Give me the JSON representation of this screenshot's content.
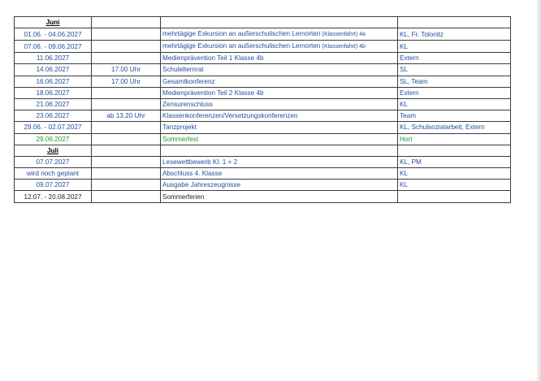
{
  "months": [
    {
      "name": "Juni",
      "rows": [
        {
          "date": "01.06. - 04.06.2027",
          "time": "",
          "event": "mehrtägige Exkursion an außerschulischen Lernorten",
          "event_note": "(Klassenfahrt) 4a",
          "resp": "KL, Fr. Tolonitz",
          "color": "blue"
        },
        {
          "date": "07.06. - 09.06.2027",
          "time": "",
          "event": "mehrtägige Exkursion an außerschulischen Lernorten",
          "event_note": "(Klassenfahrt) 4b",
          "resp": "KL",
          "color": "blue"
        },
        {
          "date": "11.06.2027",
          "time": "",
          "event": "Medienprävention Teil 1 Klasse 4b",
          "event_note": "",
          "resp": "Extern",
          "color": "blue"
        },
        {
          "date": "14.06.2027",
          "time": "17.00 Uhr",
          "event": "Schulelternrat",
          "event_note": "",
          "resp": "SL",
          "color": "blue"
        },
        {
          "date": "16.06.2027",
          "time": "17.00 Uhr",
          "event": "Gesamtkonferenz",
          "event_note": "",
          "resp": "SL, Team",
          "color": "blue"
        },
        {
          "date": "18.06.2027",
          "time": "",
          "event": "Medienprävention Teil 2 Klasse 4b",
          "event_note": "",
          "resp": "Extern",
          "color": "blue"
        },
        {
          "date": "21.06.2027",
          "time": "",
          "event": "Zensurenschluss",
          "event_note": "",
          "resp": "KL",
          "color": "blue"
        },
        {
          "date": "23.06.2027",
          "time": "ab 13.20 Uhr",
          "event": "Klassenkonferenzen/Versetzungskonferenzen",
          "event_note": "",
          "resp": "Team",
          "color": "blue"
        },
        {
          "date": "29.06. - 02.07.2027",
          "time": "",
          "event": "Tanzprojekt",
          "event_note": "",
          "resp": "KL, Schulsozialarbeit, Extern",
          "color": "blue"
        },
        {
          "date": "29.06.2027",
          "time": "",
          "event": "Sommerfest",
          "event_note": "",
          "resp": "Hort",
          "color": "green"
        }
      ]
    },
    {
      "name": "Juli",
      "rows": [
        {
          "date": "07.07.2027",
          "time": "",
          "event": "Lesewettbewerb Kl. 1 + 2",
          "event_note": "",
          "resp": "KL, PM",
          "color": "blue"
        },
        {
          "date": "wird noch geplant",
          "time": "",
          "event": "Abschluss 4. Klasse",
          "event_note": "",
          "resp": "KL",
          "color": "blue"
        },
        {
          "date": "09.07.2027",
          "time": "",
          "event": "Ausgabe Jahreszeugnisse",
          "event_note": "",
          "resp": "KL",
          "color": "blue"
        },
        {
          "date": "12.07. - 20.08.2027",
          "time": "",
          "event": "Sommerferien",
          "event_note": "",
          "resp": "",
          "color": "dark"
        }
      ]
    }
  ],
  "colors": {
    "blue": "#1f4e9e",
    "green": "#1a9a2a",
    "dark": "#222222"
  }
}
